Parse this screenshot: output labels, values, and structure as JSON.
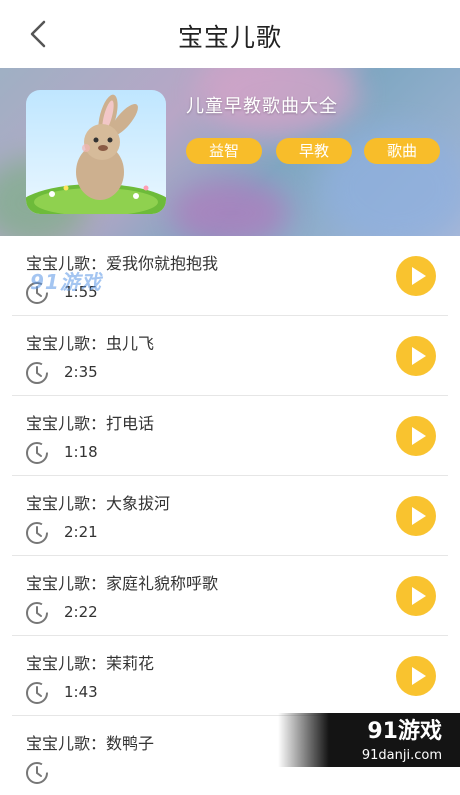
{
  "header": {
    "title": "宝宝儿歌"
  },
  "album": {
    "title": "儿童早教歌曲大全",
    "tags": [
      "益智",
      "早教",
      "歌曲"
    ]
  },
  "songs": [
    {
      "title": "宝宝儿歌：爱我你就抱抱我",
      "duration": "1:55"
    },
    {
      "title": "宝宝儿歌：虫儿飞",
      "duration": "2:35"
    },
    {
      "title": "宝宝儿歌：打电话",
      "duration": "1:18"
    },
    {
      "title": "宝宝儿歌：大象拔河",
      "duration": "2:21"
    },
    {
      "title": "宝宝儿歌：家庭礼貌称呼歌",
      "duration": "2:22"
    },
    {
      "title": "宝宝儿歌：茉莉花",
      "duration": "1:43"
    },
    {
      "title": "宝宝儿歌：数鸭子",
      "duration": ""
    }
  ],
  "watermark": {
    "overlay": "91游戏",
    "logo": "91游戏",
    "site": "91danji.com"
  },
  "colors": {
    "accent": "#f9c32f",
    "tag": "#f8bd2a"
  }
}
